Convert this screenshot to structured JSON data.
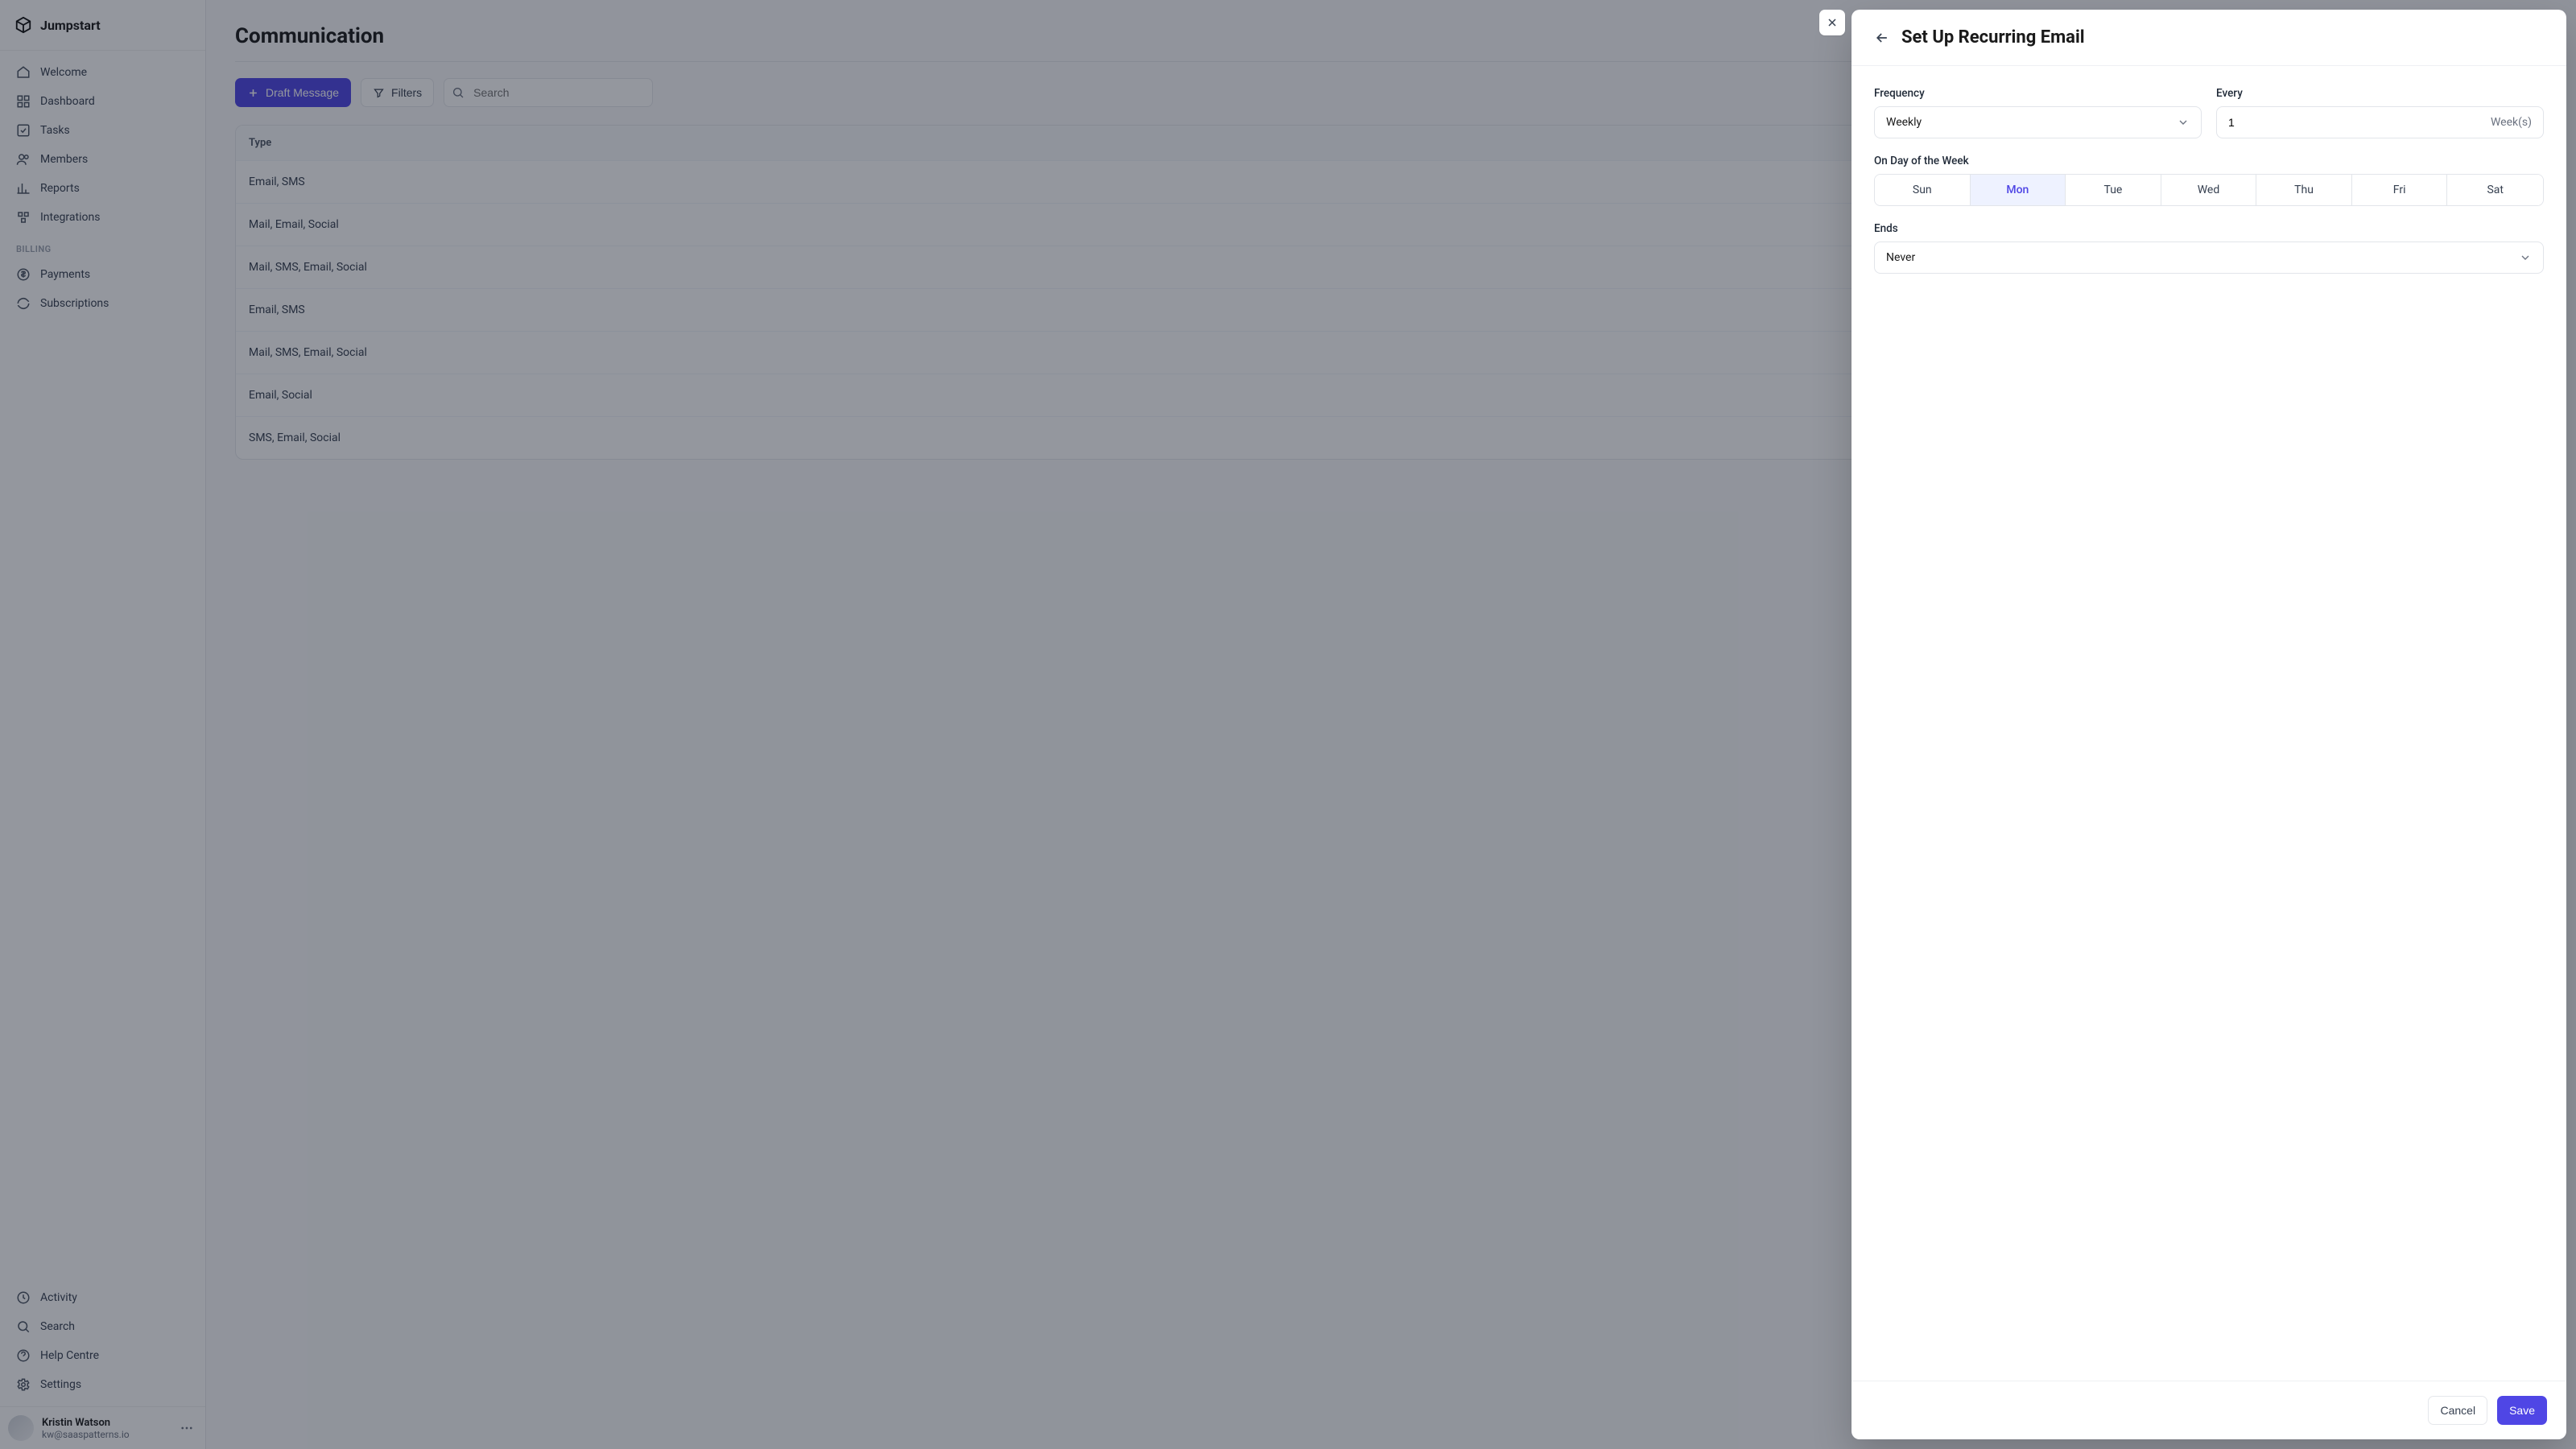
{
  "brand": {
    "name": "Jumpstart"
  },
  "sidebar": {
    "main_items": [
      {
        "label": "Welcome"
      },
      {
        "label": "Dashboard"
      },
      {
        "label": "Tasks"
      },
      {
        "label": "Members"
      },
      {
        "label": "Reports"
      },
      {
        "label": "Integrations"
      }
    ],
    "billing_label": "BILLING",
    "billing_items": [
      {
        "label": "Payments"
      },
      {
        "label": "Subscriptions"
      }
    ],
    "bottom_items": [
      {
        "label": "Activity"
      },
      {
        "label": "Search"
      },
      {
        "label": "Help Centre"
      },
      {
        "label": "Settings"
      }
    ]
  },
  "user": {
    "name": "Kristin Watson",
    "email": "kw@saaspatterns.io"
  },
  "page": {
    "title": "Communication",
    "draft_button": "Draft Message",
    "filters_button": "Filters",
    "search_placeholder": "Search"
  },
  "table": {
    "header": "Type",
    "rows": [
      "Email, SMS",
      "Mail, Email, Social",
      "Mail, SMS, Email, Social",
      "Email, SMS",
      "Mail, SMS, Email, Social",
      "Email, Social",
      "SMS, Email, Social"
    ]
  },
  "modal": {
    "title": "Set Up Recurring Email",
    "frequency_label": "Frequency",
    "frequency_value": "Weekly",
    "every_label": "Every",
    "every_value": "1",
    "every_unit": "Week(s)",
    "day_label": "On Day of the Week",
    "days": [
      "Sun",
      "Mon",
      "Tue",
      "Wed",
      "Thu",
      "Fri",
      "Sat"
    ],
    "selected_day_index": 1,
    "ends_label": "Ends",
    "ends_value": "Never",
    "cancel": "Cancel",
    "save": "Save"
  }
}
